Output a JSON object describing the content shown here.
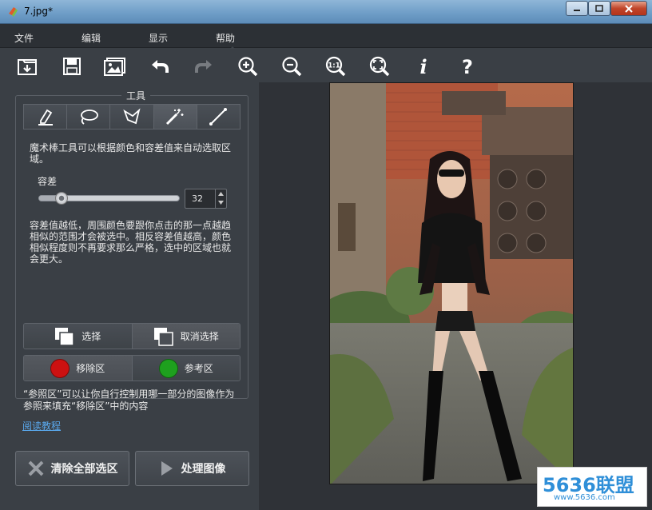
{
  "window": {
    "title": "7.jpg*"
  },
  "menu": {
    "items": [
      "文件",
      "编辑",
      "显示",
      "帮助"
    ]
  },
  "toolbar": {
    "buttons": [
      "open-icon",
      "save-icon",
      "image-icon",
      "undo-icon",
      "redo-icon",
      "zoom-in-icon",
      "zoom-out-icon",
      "zoom-actual-icon",
      "zoom-fit-icon",
      "info-icon",
      "help-icon"
    ],
    "zoom_actual_label": "1:1",
    "info_label": "i",
    "help_label": "?"
  },
  "tools": {
    "legend": "工具",
    "tabs": [
      "marker-icon",
      "lasso-icon",
      "polygon-lasso-icon",
      "magic-wand-icon",
      "line-icon"
    ],
    "active_tab": "magic-wand-icon",
    "description": "魔术棒工具可以根据颜色和容差值来自动选取区域。",
    "tolerance_label": "容差",
    "tolerance_value": "32",
    "help_text": "容差值越低，周围颜色要跟你点击的那一点越趋相似的范围才会被选中。相反容差值越高，颜色相似程度则不再要求那么严格，选中的区域也就会更大。"
  },
  "selection": {
    "select_label": "选择",
    "deselect_label": "取消选择"
  },
  "regions": {
    "remove_label": "移除区",
    "reference_label": "参考区",
    "remove_color": "#cc1111",
    "reference_color": "#1ea01e",
    "description": "“参照区”可以让你自行控制用哪一部分的图像作为参照来填充“移除区”中的内容"
  },
  "link": {
    "tutorial": "阅读教程"
  },
  "actions": {
    "clear_all": "清除全部选区",
    "process": "处理图像"
  },
  "watermark": {
    "brand": "5636联盟",
    "url": "www.5636.com"
  }
}
